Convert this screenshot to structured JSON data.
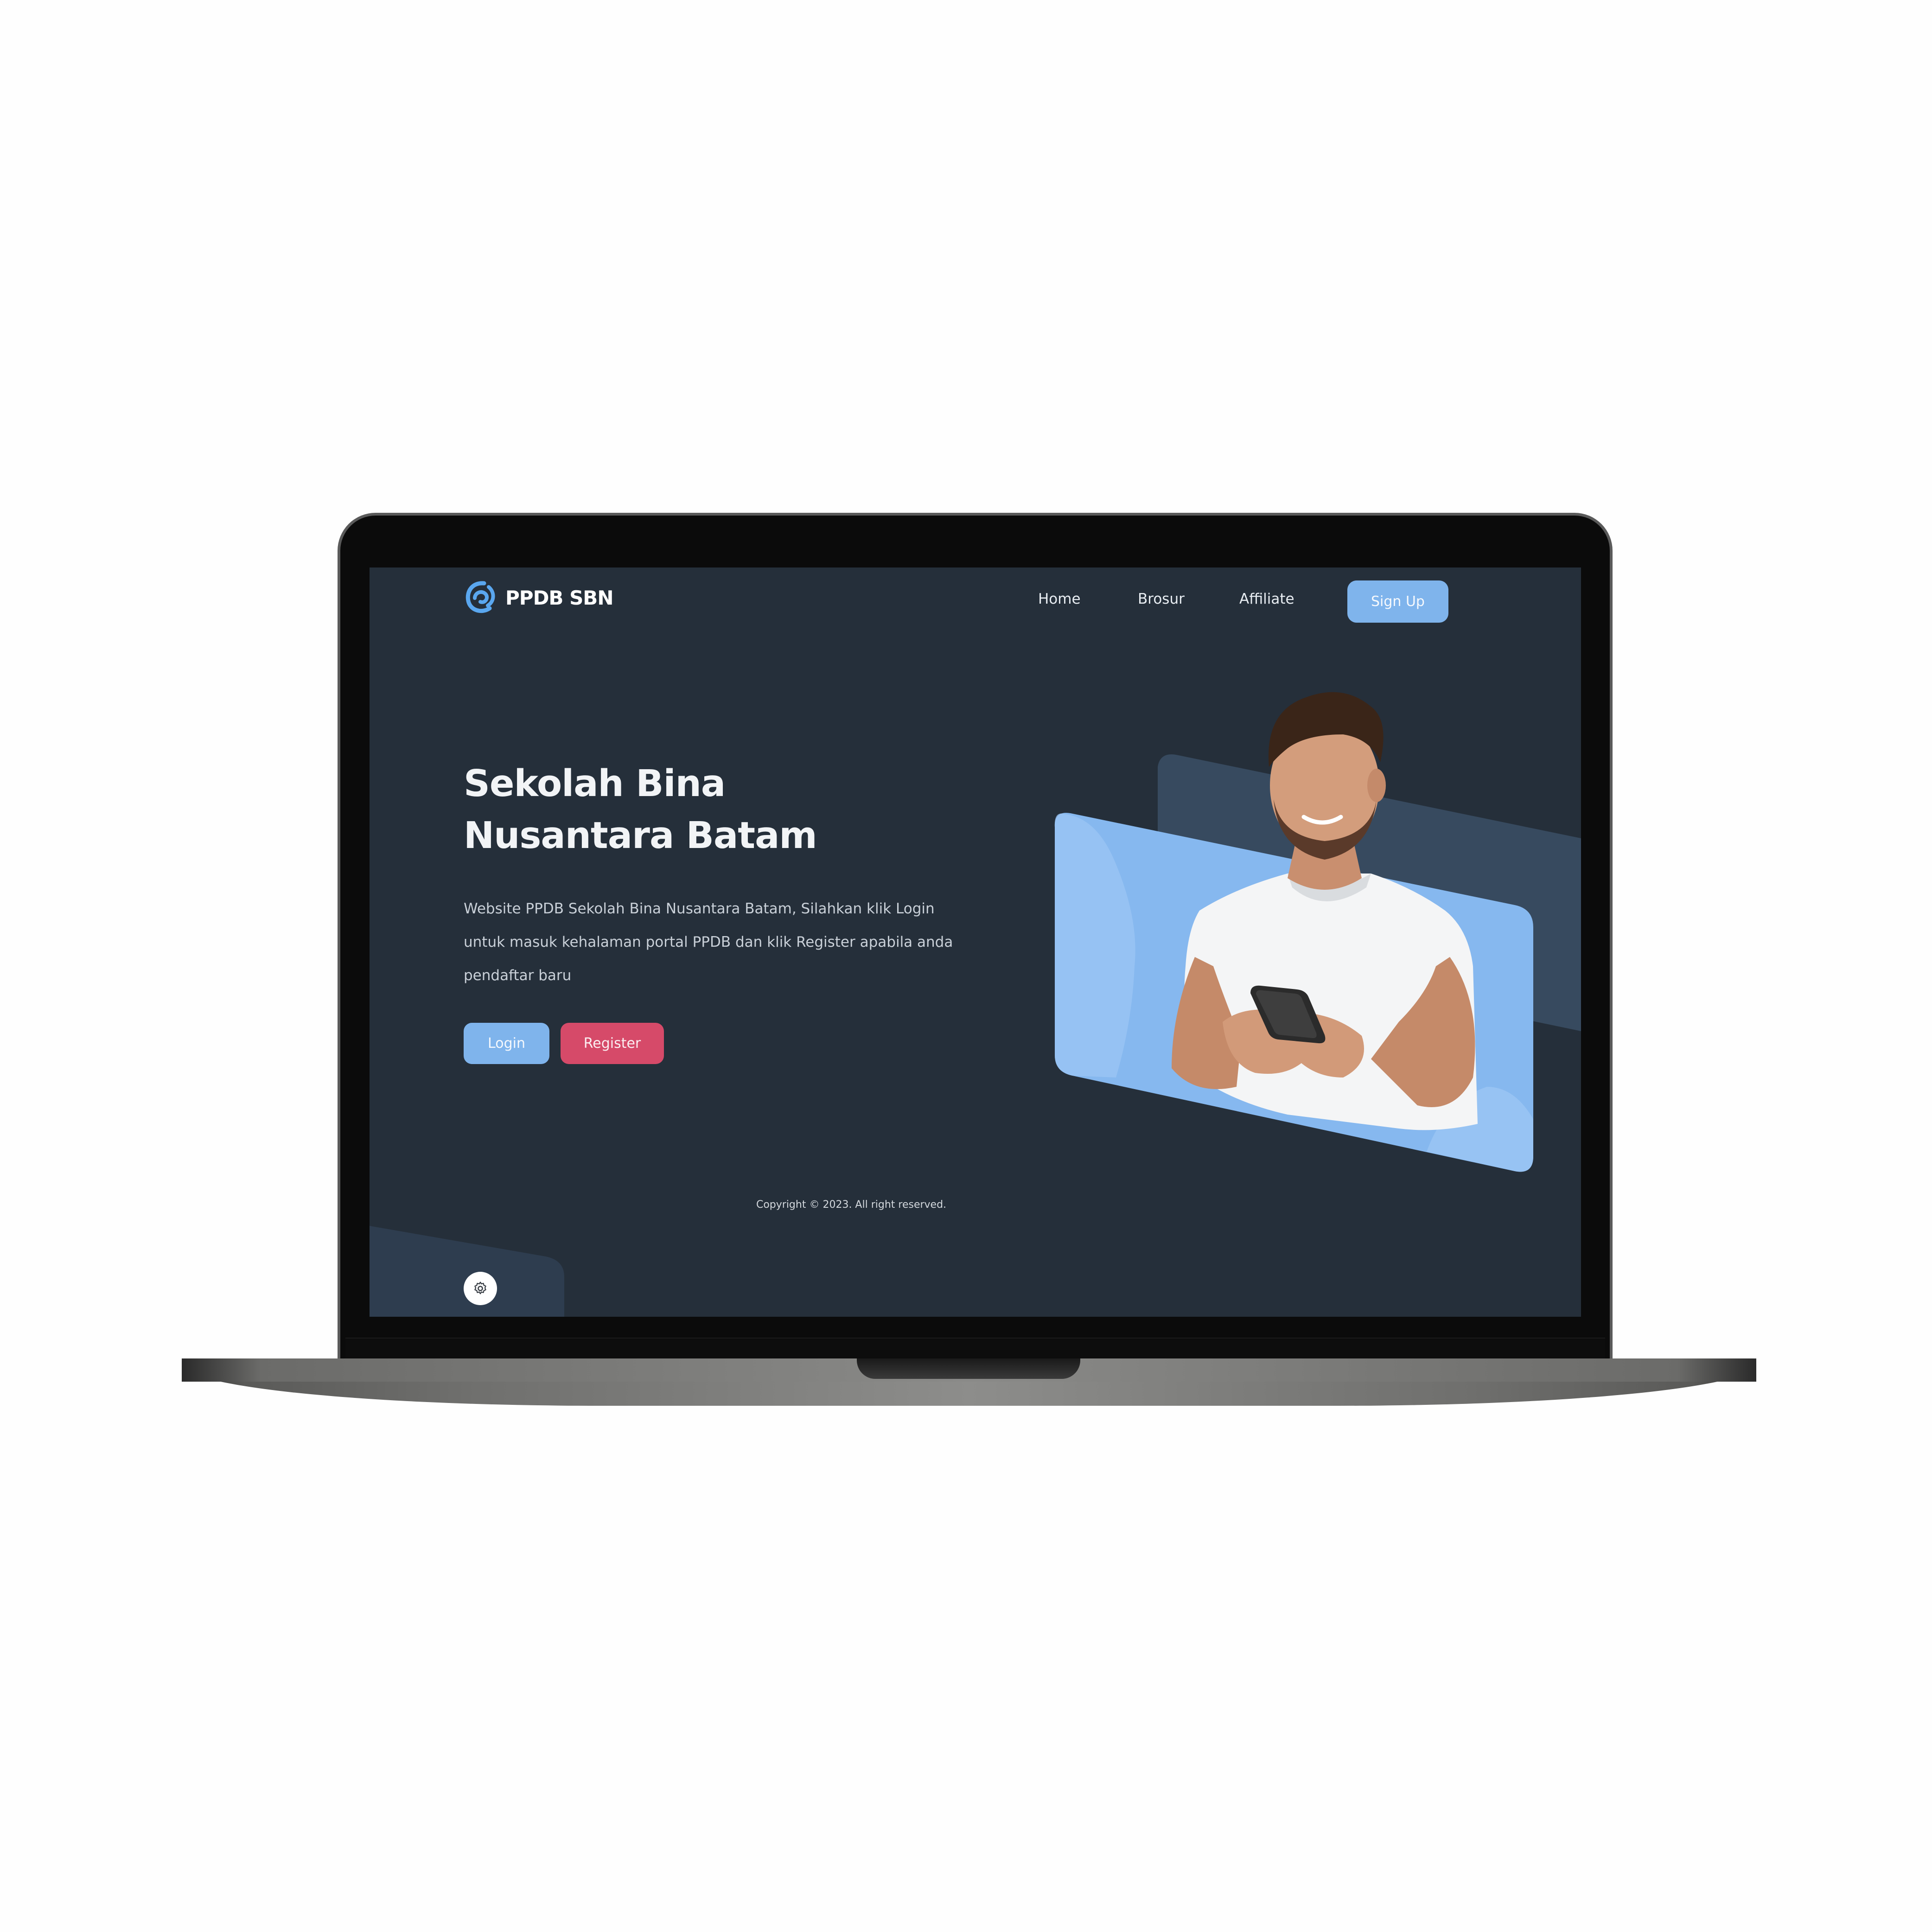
{
  "brand": {
    "name": "PPDB SBN",
    "logo_icon": "swirl-logo-icon"
  },
  "nav": {
    "links": [
      "Home",
      "Brosur",
      "Affiliate"
    ],
    "signup_label": "Sign Up"
  },
  "hero": {
    "title_line1": "Sekolah Bina",
    "title_line2": "Nusantara Batam",
    "description": "Website PPDB Sekolah Bina Nusantara Batam, Silahkan klik Login untuk masuk kehalaman portal PPDB dan klik Register apabila anda pendaftar baru",
    "login_label": "Login",
    "register_label": "Register",
    "illustration": "man-holding-smartphone-photo"
  },
  "footer": {
    "copyright": "Copyright © 2023. All right reserved.",
    "settings_icon": "gear-icon"
  },
  "colors": {
    "background": "#252f3a",
    "accent_blue": "#7fb4ec",
    "accent_pink": "#d64a69",
    "panel_dark": "#374a5f"
  }
}
